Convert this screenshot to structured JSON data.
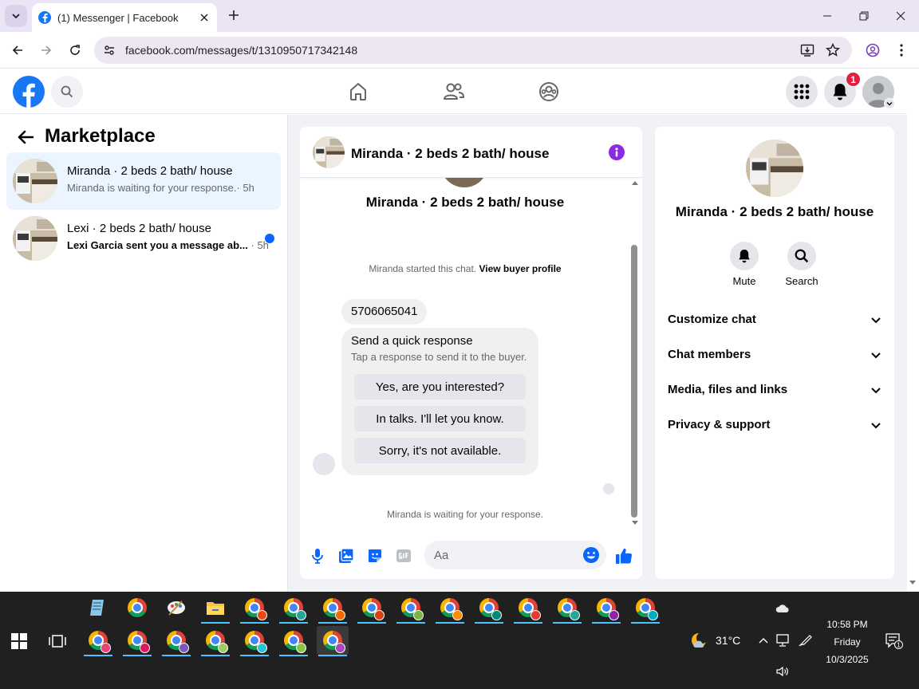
{
  "browser": {
    "tab_title": "(1) Messenger | Facebook",
    "url": "facebook.com/messages/t/1310950717342148"
  },
  "fb_header": {
    "notification_count": "1"
  },
  "left_panel": {
    "title": "Marketplace",
    "conversations": [
      {
        "name": "Miranda · 2 beds 2 bath/ house",
        "preview": "Miranda is waiting for your response.",
        "time": "· 5h",
        "active": true,
        "unread": false
      },
      {
        "name": "Lexi · 2 beds 2 bath/ house",
        "preview": "Lexi Garcia sent you a message ab...",
        "time": "· 5h",
        "active": false,
        "unread": true
      }
    ]
  },
  "chat": {
    "header_name": "Miranda · 2 beds 2 bath/ house",
    "center_title": "Miranda · 2 beds 2 bath/ house",
    "started_text": "Miranda started this chat.",
    "buyer_profile_link": "View buyer profile",
    "phone_message": "5706065041",
    "quick_response": {
      "title": "Send a quick response",
      "subtitle": "Tap a response to send it to the buyer.",
      "options": [
        "Yes, are you interested?",
        "In talks. I'll let you know.",
        "Sorry, it's not available."
      ]
    },
    "waiting_text": "Miranda is waiting for your response.",
    "composer_placeholder": "Aa"
  },
  "info_panel": {
    "name": "Miranda · 2 beds 2 bath/ house",
    "actions": [
      {
        "label": "Mute",
        "icon": "bell-icon"
      },
      {
        "label": "Search",
        "icon": "search-icon"
      }
    ],
    "sections": [
      "Customize chat",
      "Chat members",
      "Media, files and links",
      "Privacy & support"
    ]
  },
  "taskbar": {
    "temperature": "31°C",
    "time": "10:58 PM",
    "day": "Friday",
    "date": "10/3/2025",
    "notification_count": "1"
  },
  "colors": {
    "facebook_blue": "#1877f2",
    "messenger_accent": "#8a2be2",
    "unread_dot": "#0866ff",
    "active_conversation_bg": "#ebf5ff",
    "taskbar_bg": "#202020"
  }
}
